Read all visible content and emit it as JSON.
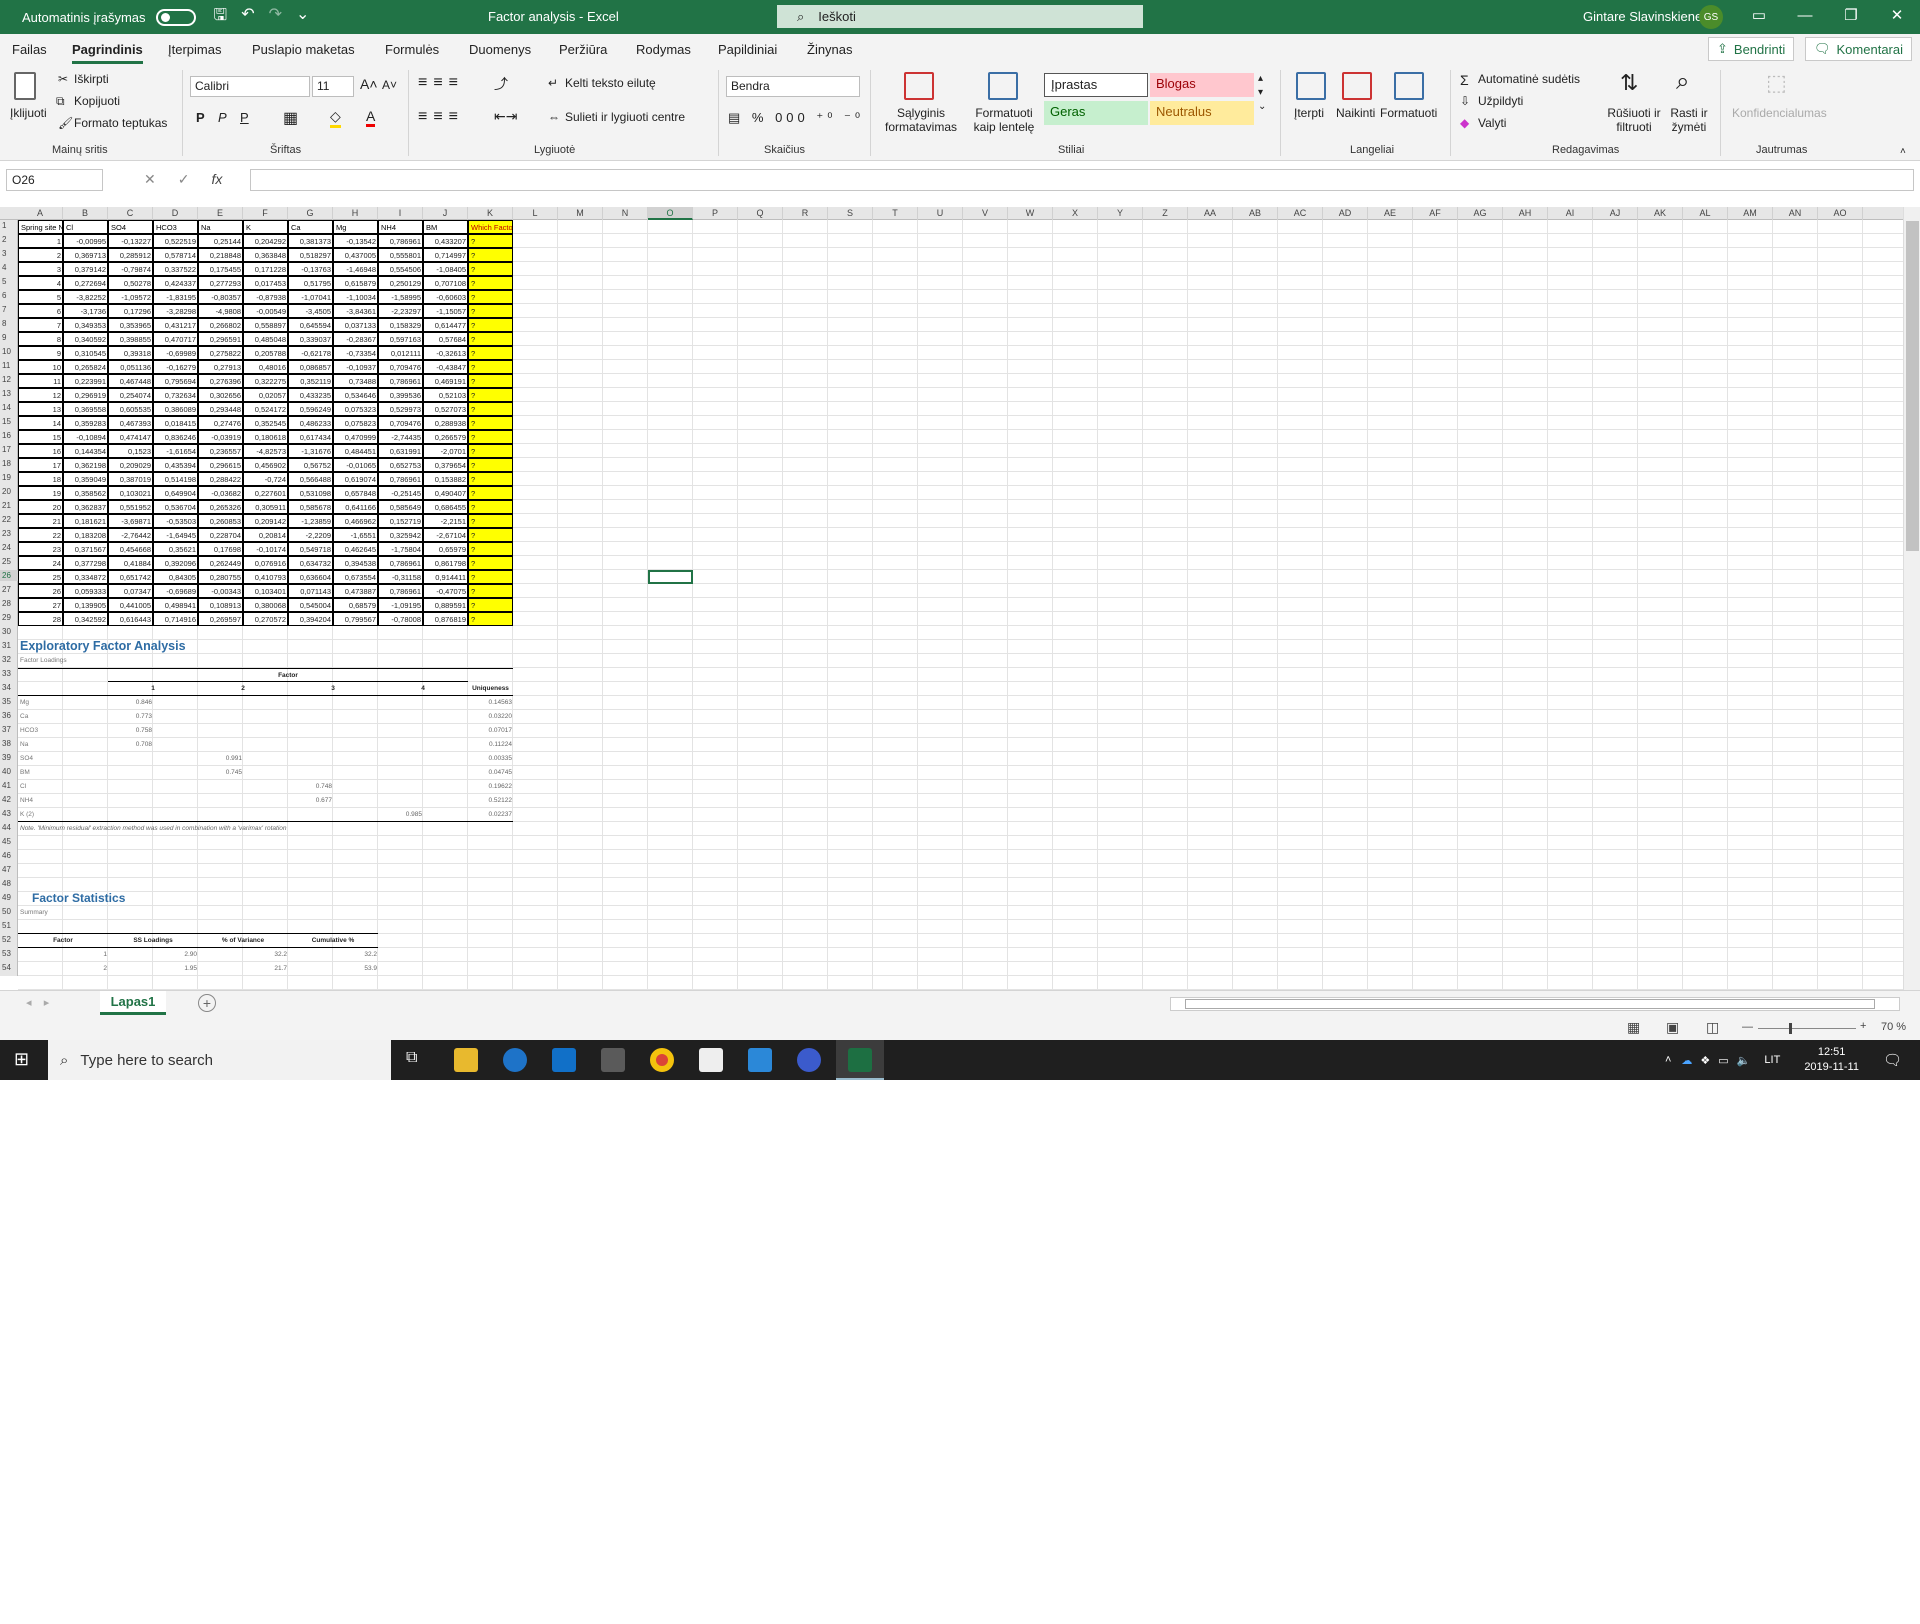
{
  "titlebar": {
    "autosave": "Automatinis įrašymas",
    "doc_title": "Factor analysis  -  Excel",
    "search_placeholder": "Ieškoti",
    "user": "Gintare Slavinskiene",
    "initials": "GS"
  },
  "menu": {
    "tabs": [
      "Failas",
      "Pagrindinis",
      "Įterpimas",
      "Puslapio maketas",
      "Formulės",
      "Duomenys",
      "Peržiūra",
      "Rodymas",
      "Papildiniai",
      "Žinynas"
    ],
    "share": "Bendrinti",
    "comments": "Komentarai"
  },
  "ribbon": {
    "paste": "Įklijuoti",
    "cut": "Iškirpti",
    "copy": "Kopijuoti",
    "format_painter": "Formato teptukas",
    "clipboard": "Mainų sritis",
    "font_name": "Calibri",
    "font_size": "11",
    "font_group": "Šriftas",
    "bold": "P",
    "italic": "P",
    "underline": "P",
    "wrap": "Kelti teksto eilutę",
    "merge": "Sulieti ir lygiuoti centre",
    "align_group": "Lygiuotė",
    "number_format": "Bendra",
    "number_group": "Skaičius",
    "cond_format": "Sąlyginis formatavimas",
    "format_table": "Formatuoti kaip lentelę",
    "style_normal": "Įprastas",
    "style_bad": "Blogas",
    "style_good": "Geras",
    "style_neutral": "Neutralus",
    "styles_group": "Stiliai",
    "insert": "Įterpti",
    "delete": "Naikinti",
    "format": "Formatuoti",
    "cells_group": "Langeliai",
    "autosum": "Automatinė sudėtis",
    "fill": "Užpildyti",
    "clear": "Valyti",
    "sort": "Rūšiuoti ir filtruoti",
    "find": "Rasti ir žymėti",
    "editing_group": "Redagavimas",
    "sensitivity": "Konfidencialumas",
    "sensitivity_group": "Jautrumas"
  },
  "formula": {
    "cell_ref": "O26",
    "fx": "fx",
    "value": ""
  },
  "columns": [
    "A",
    "B",
    "C",
    "D",
    "E",
    "F",
    "G",
    "H",
    "I",
    "J",
    "K",
    "L",
    "M",
    "N",
    "O",
    "P",
    "Q",
    "R",
    "S",
    "T",
    "U",
    "V",
    "W",
    "X",
    "Y",
    "Z",
    "AA",
    "AB",
    "AC",
    "AD",
    "AE",
    "AF",
    "AG",
    "AH",
    "AI",
    "AJ",
    "AK",
    "AL",
    "AM",
    "AN",
    "AO"
  ],
  "data_table": {
    "headers": [
      "Spring site No.",
      "Cl",
      "SO4",
      "HCO3",
      "Na",
      "K",
      "Ca",
      "Mg",
      "NH4",
      "BM",
      "Which Factor"
    ],
    "rows": [
      [
        "1",
        "-0,00995",
        "-0,13227",
        "0,522519",
        "0,25144",
        "0,204292",
        "0,381373",
        "-0,13542",
        "0,786961",
        "0,433207",
        "?"
      ],
      [
        "2",
        "0,369713",
        "0,285912",
        "0,578714",
        "0,218848",
        "0,363848",
        "0,518297",
        "0,437005",
        "0,555801",
        "0,714997",
        "?"
      ],
      [
        "3",
        "0,379142",
        "-0,79874",
        "0,337522",
        "0,175455",
        "0,171228",
        "-0,13763",
        "-1,46948",
        "0,554506",
        "-1,08405",
        "?"
      ],
      [
        "4",
        "0,272694",
        "0,50278",
        "0,424337",
        "0,277293",
        "0,017453",
        "0,51795",
        "0,615879",
        "0,250129",
        "0,707108",
        "?"
      ],
      [
        "5",
        "-3,82252",
        "-1,09572",
        "-1,83195",
        "-0,80357",
        "-0,87938",
        "-1,07041",
        "-1,10034",
        "-1,58995",
        "-0,60603",
        "?"
      ],
      [
        "6",
        "-3,1736",
        "0,17296",
        "-3,28298",
        "-4,9808",
        "-0,00549",
        "-3,4505",
        "-3,84361",
        "-2,23297",
        "-1,15057",
        "?"
      ],
      [
        "7",
        "0,349353",
        "0,353965",
        "0,431217",
        "0,266802",
        "0,558897",
        "0,645594",
        "0,037133",
        "0,158329",
        "0,614477",
        "?"
      ],
      [
        "8",
        "0,340592",
        "0,398855",
        "0,470717",
        "0,296591",
        "0,485048",
        "0,339037",
        "-0,28367",
        "0,597163",
        "0,57684",
        "?"
      ],
      [
        "9",
        "0,310545",
        "0,39318",
        "-0,69989",
        "0,275822",
        "0,205788",
        "-0,62178",
        "-0,73354",
        "0,012111",
        "-0,32613",
        "?"
      ],
      [
        "10",
        "0,265824",
        "0,051136",
        "-0,16279",
        "0,27913",
        "0,48016",
        "0,086857",
        "-0,10937",
        "0,709476",
        "-0,43847",
        "?"
      ],
      [
        "11",
        "0,223991",
        "0,467448",
        "0,795694",
        "0,276396",
        "0,322275",
        "0,352119",
        "0,73488",
        "0,786961",
        "0,469191",
        "?"
      ],
      [
        "12",
        "0,296919",
        "0,254074",
        "0,732634",
        "0,302656",
        "0,02057",
        "0,433235",
        "0,534646",
        "0,399536",
        "0,52103",
        "?"
      ],
      [
        "13",
        "0,369558",
        "0,605535",
        "0,386089",
        "0,293448",
        "0,524172",
        "0,596249",
        "0,075323",
        "0,529973",
        "0,527073",
        "?"
      ],
      [
        "14",
        "0,359283",
        "0,467393",
        "0,018415",
        "0,27476",
        "0,352545",
        "0,486233",
        "0,075823",
        "0,709476",
        "0,288938",
        "?"
      ],
      [
        "15",
        "-0,10894",
        "0,474147",
        "0,836246",
        "-0,03919",
        "0,180618",
        "0,617434",
        "0,470999",
        "-2,74435",
        "0,266579",
        "?"
      ],
      [
        "16",
        "0,144354",
        "0,1523",
        "-1,61654",
        "0,236557",
        "-4,82573",
        "-1,31676",
        "0,484451",
        "0,631991",
        "-2,0701",
        "?"
      ],
      [
        "17",
        "0,362198",
        "0,209029",
        "0,435394",
        "0,296615",
        "0,456902",
        "0,56752",
        "-0,01065",
        "0,652753",
        "0,379654",
        "?"
      ],
      [
        "18",
        "0,359049",
        "0,387019",
        "0,514198",
        "0,288422",
        "-0,724",
        "0,566488",
        "0,619074",
        "0,786961",
        "0,153882",
        "?"
      ],
      [
        "19",
        "0,358562",
        "0,103021",
        "0,649904",
        "-0,03682",
        "0,227601",
        "0,531098",
        "0,657848",
        "-0,25145",
        "0,490407",
        "?"
      ],
      [
        "20",
        "0,362837",
        "0,551952",
        "0,536704",
        "0,265326",
        "0,305911",
        "0,585678",
        "0,641166",
        "0,585649",
        "0,686455",
        "?"
      ],
      [
        "21",
        "0,181621",
        "-3,69871",
        "-0,53503",
        "0,260853",
        "0,209142",
        "-1,23859",
        "0,466962",
        "0,152719",
        "-2,2151",
        "?"
      ],
      [
        "22",
        "0,183208",
        "-2,76442",
        "-1,64945",
        "0,228704",
        "0,20814",
        "-2,2209",
        "-1,6551",
        "0,325942",
        "-2,67104",
        "?"
      ],
      [
        "23",
        "0,371567",
        "0,454668",
        "0,35621",
        "0,17698",
        "-0,10174",
        "0,549718",
        "0,462645",
        "-1,75804",
        "0,65979",
        "?"
      ],
      [
        "24",
        "0,377298",
        "0,41884",
        "0,392096",
        "0,262449",
        "0,076916",
        "0,634732",
        "0,394538",
        "0,786961",
        "0,861798",
        "?"
      ],
      [
        "25",
        "0,334872",
        "0,651742",
        "0,84305",
        "0,280755",
        "0,410793",
        "0,636604",
        "0,673554",
        "-0,31158",
        "0,914411",
        "?"
      ],
      [
        "26",
        "0,059333",
        "0,07347",
        "-0,69689",
        "-0,00343",
        "0,103401",
        "0,071143",
        "0,473887",
        "0,786961",
        "-0,47075",
        "?"
      ],
      [
        "27",
        "0,139905",
        "0,441005",
        "0,498941",
        "0,108913",
        "0,380068",
        "0,545004",
        "0,68579",
        "-1,09195",
        "0,889591",
        "?"
      ],
      [
        "28",
        "0,342592",
        "0,616443",
        "0,714916",
        "0,269597",
        "0,270572",
        "0,394204",
        "0,799567",
        "-0,78008",
        "0,876819",
        "?"
      ]
    ]
  },
  "efa": {
    "title": "Exploratory Factor Analysis",
    "subtitle": "Factor Loadings",
    "factor_label": "Factor",
    "uniqueness_label": "Uniqueness",
    "factor_numbers": [
      "1",
      "2",
      "3",
      "4"
    ],
    "rows": [
      {
        "var": "Mg",
        "f1": "0.846",
        "f2": "",
        "f3": "",
        "f4": "",
        "u": "0.14563"
      },
      {
        "var": "Ca",
        "f1": "0.773",
        "f2": "",
        "f3": "",
        "f4": "",
        "u": "0.03220"
      },
      {
        "var": "HCO3",
        "f1": "0.758",
        "f2": "",
        "f3": "",
        "f4": "",
        "u": "0.07017"
      },
      {
        "var": "Na",
        "f1": "0.708",
        "f2": "",
        "f3": "",
        "f4": "",
        "u": "0.11224"
      },
      {
        "var": "SO4",
        "f1": "",
        "f2": "0.991",
        "f3": "",
        "f4": "",
        "u": "0.00335"
      },
      {
        "var": "BM",
        "f1": "",
        "f2": "0.745",
        "f3": "",
        "f4": "",
        "u": "0.04745"
      },
      {
        "var": "Cl",
        "f1": "",
        "f2": "",
        "f3": "0.748",
        "f4": "",
        "u": "0.19622"
      },
      {
        "var": "NH4",
        "f1": "",
        "f2": "",
        "f3": "0.677",
        "f4": "",
        "u": "0.52122"
      },
      {
        "var": "K (2)",
        "f1": "",
        "f2": "",
        "f3": "",
        "f4": "0.985",
        "u": "0.02237"
      }
    ],
    "note": "Note.  'Minimum residual' extraction method was used in combination with a 'varimax' rotation"
  },
  "fs": {
    "title": "Factor Statistics",
    "subtitle": "Summary",
    "headers": [
      "Factor",
      "SS Loadings",
      "% of Variance",
      "Cumulative %"
    ],
    "rows": [
      [
        "1",
        "2.90",
        "32.2",
        "32.2"
      ],
      [
        "2",
        "1.95",
        "21.7",
        "53.9"
      ]
    ]
  },
  "sheet_tabs": {
    "active": "Lapas1"
  },
  "status": {
    "zoom": "70 %"
  },
  "taskbar": {
    "search": "Type here to search",
    "lang": "LIT",
    "time": "12:51",
    "date": "2019-11-11"
  }
}
